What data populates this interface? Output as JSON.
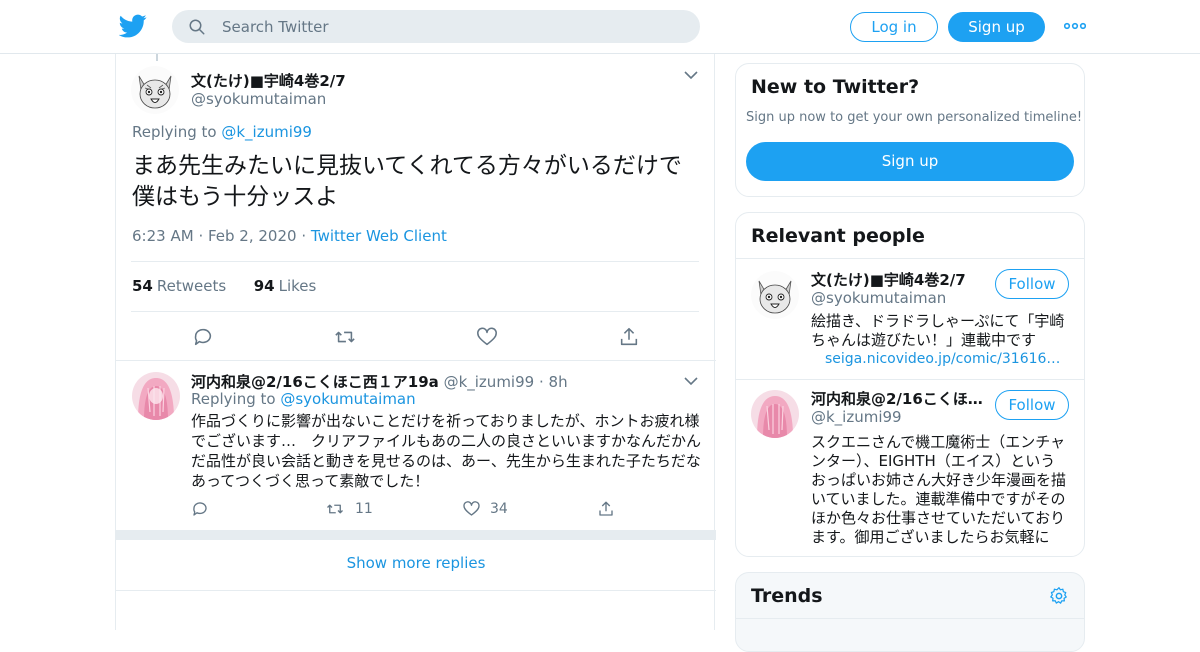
{
  "header": {
    "search_placeholder": "Search Twitter",
    "login_label": "Log in",
    "signup_label": "Sign up",
    "brand_color": "#1da1f2"
  },
  "tweet": {
    "author_name": "文(たけ)■宇崎4巻2/7",
    "author_handle": "@syokumutaiman",
    "replying_prefix": "Replying to",
    "replying_to": "@k_izumi99",
    "text": "まあ先生みたいに見抜いてくれてる方々がいるだけで僕はもう十分ッスよ",
    "time": "6:23 AM",
    "date": "Feb 2, 2020",
    "client": "Twitter Web Client",
    "retweets_count": "54",
    "retweets_label": "Retweets",
    "likes_count": "94",
    "likes_label": "Likes"
  },
  "reply": {
    "author_name": "河内和泉@2/16こくほこ西１ア19a",
    "author_handle": "@k_izumi99",
    "time": "8h",
    "replying_prefix": "Replying to",
    "replying_to": "@syokumutaiman",
    "text": "作品づくりに影響が出ないことだけを祈っておりましたが、ホントお疲れ様でございます…　クリアファイルもあの二人の良さといいますかなんだかんだ品性が良い会話と動きを見せるのは、あー、先生から生まれた子たちだなあってつくづく思って素敵でした！",
    "retweets": "11",
    "likes": "34"
  },
  "show_more": "Show more replies",
  "sidebar": {
    "new_title": "New to Twitter?",
    "new_sub": "Sign up now to get your own personalized timeline!",
    "new_button": "Sign up",
    "people_title": "Relevant people",
    "people": [
      {
        "name": "文(たけ)■宇崎4巻2/7",
        "handle": "@syokumutaiman",
        "follow": "Follow",
        "bio": "絵描き、ドラドラしゃーぷにて「宇崎ちゃんは遊びたい！」連載中です",
        "link": "seiga.nicovideo.jp/comic/31616?tr…"
      },
      {
        "name": "河内和泉@2/16こくほこ…",
        "handle": "@k_izumi99",
        "follow": "Follow",
        "bio": "スクエニさんで機工魔術士（エンチャンター）、EIGHTH（エイス）というおっぱいお姉さん大好き少年漫画を描いていました。連載準備中ですがそのほか色々お仕事させていただいております。御用ございましたらお気軽に"
      }
    ],
    "trends_title": "Trends"
  }
}
